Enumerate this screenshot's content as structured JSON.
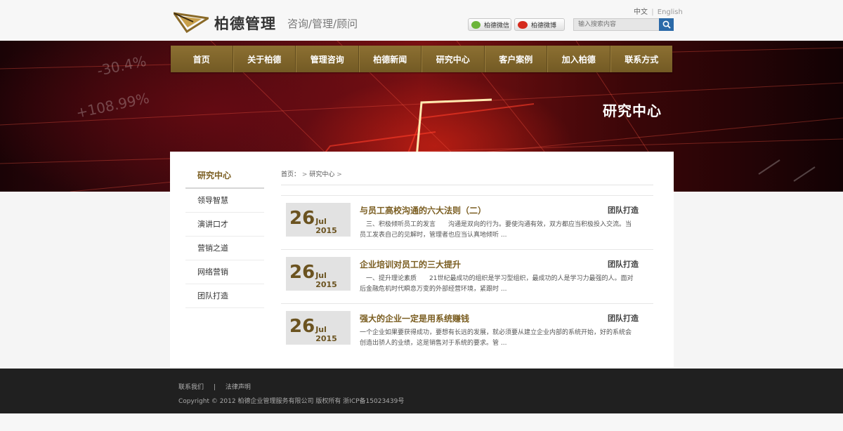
{
  "header": {
    "brand": "柏德管理",
    "slogan": "咨询/管理/顾问",
    "lang_cn": "中文",
    "lang_sep": "|",
    "lang_en": "English",
    "wechat_label": "柏德微信",
    "weibo_label": "柏德微博",
    "search_placeholder": "输入搜索内容"
  },
  "nav": {
    "items": [
      "首页",
      "关于柏德",
      "管理咨询",
      "柏德新闻",
      "研究中心",
      "客户案例",
      "加入柏德",
      "联系方式"
    ]
  },
  "banner": {
    "title": "研究中心"
  },
  "sidebar": {
    "title": "研究中心",
    "items": [
      "领导智慧",
      "演讲口才",
      "营销之道",
      "网络营销",
      "团队打造"
    ]
  },
  "breadcrumb": {
    "home": "首页：",
    "sep": ">",
    "current": "研究中心",
    "trail": ">"
  },
  "articles": [
    {
      "day": "26",
      "month_year": "Jul 2015",
      "title": "与员工高校沟通的六大法则（二）",
      "category": "团队打造",
      "summary": "　三、积极倾听员工的发言　　沟通是双向的行为。要使沟通有效，双方都应当积极投入交流。当员工发表自己的见解时，管理者也应当认真地倾听 ..."
    },
    {
      "day": "26",
      "month_year": "Jul 2015",
      "title": "企业培训对员工的三大提升",
      "category": "团队打造",
      "summary": "　一、提升理论素质　　21世纪最成功的组织是学习型组织，最成功的人是学习力最强的人。面对后金融危机时代瞬息万变的外部经营环境，紧跟时 ..."
    },
    {
      "day": "26",
      "month_year": "Jul 2015",
      "title": "强大的企业一定是用系统赚钱",
      "category": "团队打造",
      "summary": "一个企业如果要获得成功，要想有长远的发展，就必须要从建立企业内部的系统开始，好的系统会创造出骄人的业绩，这是销售对于系统的要求。管 ..."
    }
  ],
  "footer": {
    "link_contact": "联系我们",
    "link_sep": "|",
    "link_legal": "法律声明",
    "copyright": "Copyright © 2012 柏德企业管理服务有限公司 版权所有 浙ICP备15023439号"
  },
  "colors": {
    "brand_gold": "#7a5d20",
    "nav_bg": "#8c7032",
    "footer_bg": "#202020",
    "search_button": "#2b6aa8"
  },
  "icons": {
    "logo": "triangle-logo-icon",
    "wechat": "wechat-icon",
    "weibo": "weibo-icon",
    "search": "search-icon"
  }
}
